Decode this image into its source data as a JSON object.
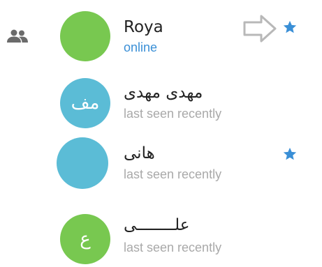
{
  "side_icon": "contacts-group-icon",
  "contacts": [
    {
      "name": "Roya",
      "status": "online",
      "avatar_text": "",
      "avatar_color": "#78c850",
      "starred": true,
      "status_color": "#3a8fd6"
    },
    {
      "name": "مهدی  مهدی",
      "status": "last seen recently",
      "avatar_text": "مف",
      "avatar_color": "#5bbcd6",
      "starred": false
    },
    {
      "name": "هانی",
      "status": "last seen recently",
      "avatar_text": "",
      "avatar_color": "#5bbcd6",
      "starred": true
    },
    {
      "name": "علــــــــی",
      "status": "last seen recently",
      "avatar_text": "ع",
      "avatar_color": "#78c850",
      "starred": false
    }
  ],
  "colors": {
    "star": "#3a8fd6",
    "status_gray": "#a9a9a9",
    "arrow_gray": "#b8b8b8"
  },
  "icons": {
    "star": "star-icon",
    "arrow": "right-arrow-icon"
  }
}
